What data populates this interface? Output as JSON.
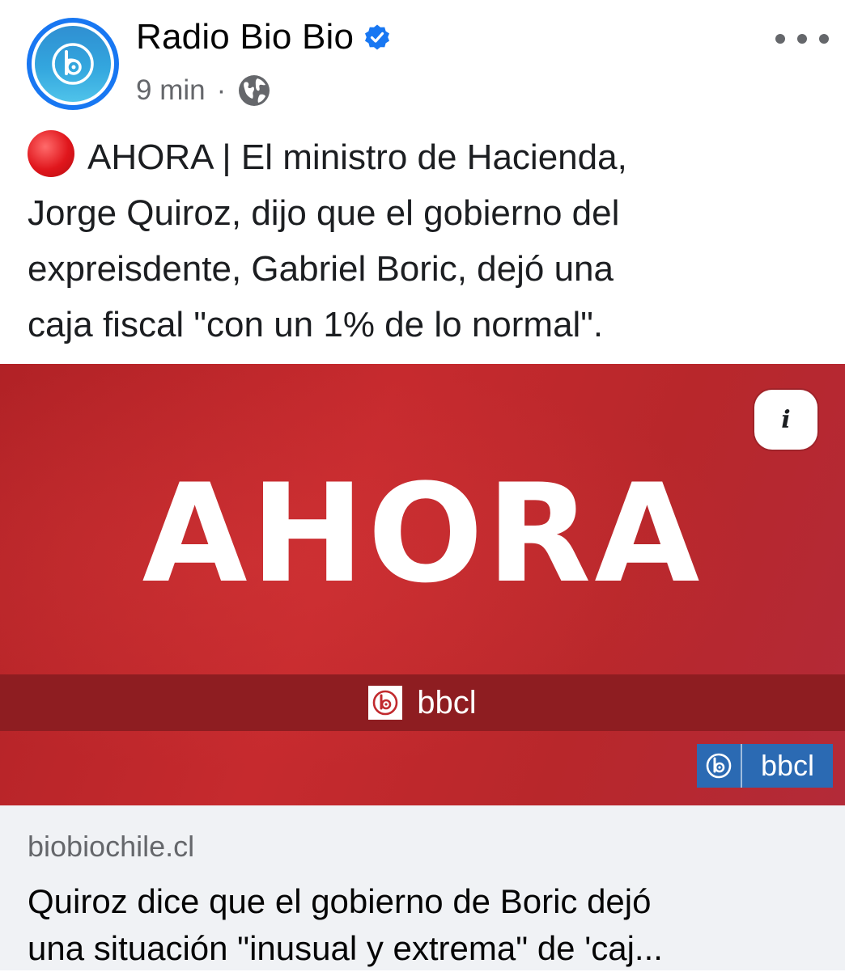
{
  "post": {
    "page_name": "Radio Bio Bio",
    "verified": true,
    "time": "9 min",
    "separator": "·",
    "audience_icon": "globe-icon",
    "text": "AHORA | El ministro de Hacienda, Jorge Quiroz, dijo que el gobierno del expreisdente, Gabriel Boric, dejó una caja fiscal \"con un 1% de lo normal\".",
    "text_lines": [
      "AHORA | El ministro de Hacienda,",
      "Jorge Quiroz, dijo que el gobierno del",
      "expreisdente, Gabriel Boric, dejó una",
      "caja fiscal \"con un 1% de lo normal\"."
    ],
    "lead_emoji": "red-circle-icon"
  },
  "media": {
    "headline": "AHORA",
    "band_label": "bbcl",
    "badge_label": "bbcl",
    "info_label": "i",
    "colors": {
      "background": "#c12a2e",
      "band": "#8e1d21",
      "badge": "#2b6ab3"
    }
  },
  "link": {
    "domain": "biobiochile.cl",
    "title_lines": [
      "Quiroz dice que el gobierno de Boric dejó",
      "una situación \"inusual y extrema\" de 'caj..."
    ]
  },
  "colors": {
    "verified": "#1877f2",
    "meta_text": "#65676b",
    "preview_bg": "#f0f2f5"
  }
}
